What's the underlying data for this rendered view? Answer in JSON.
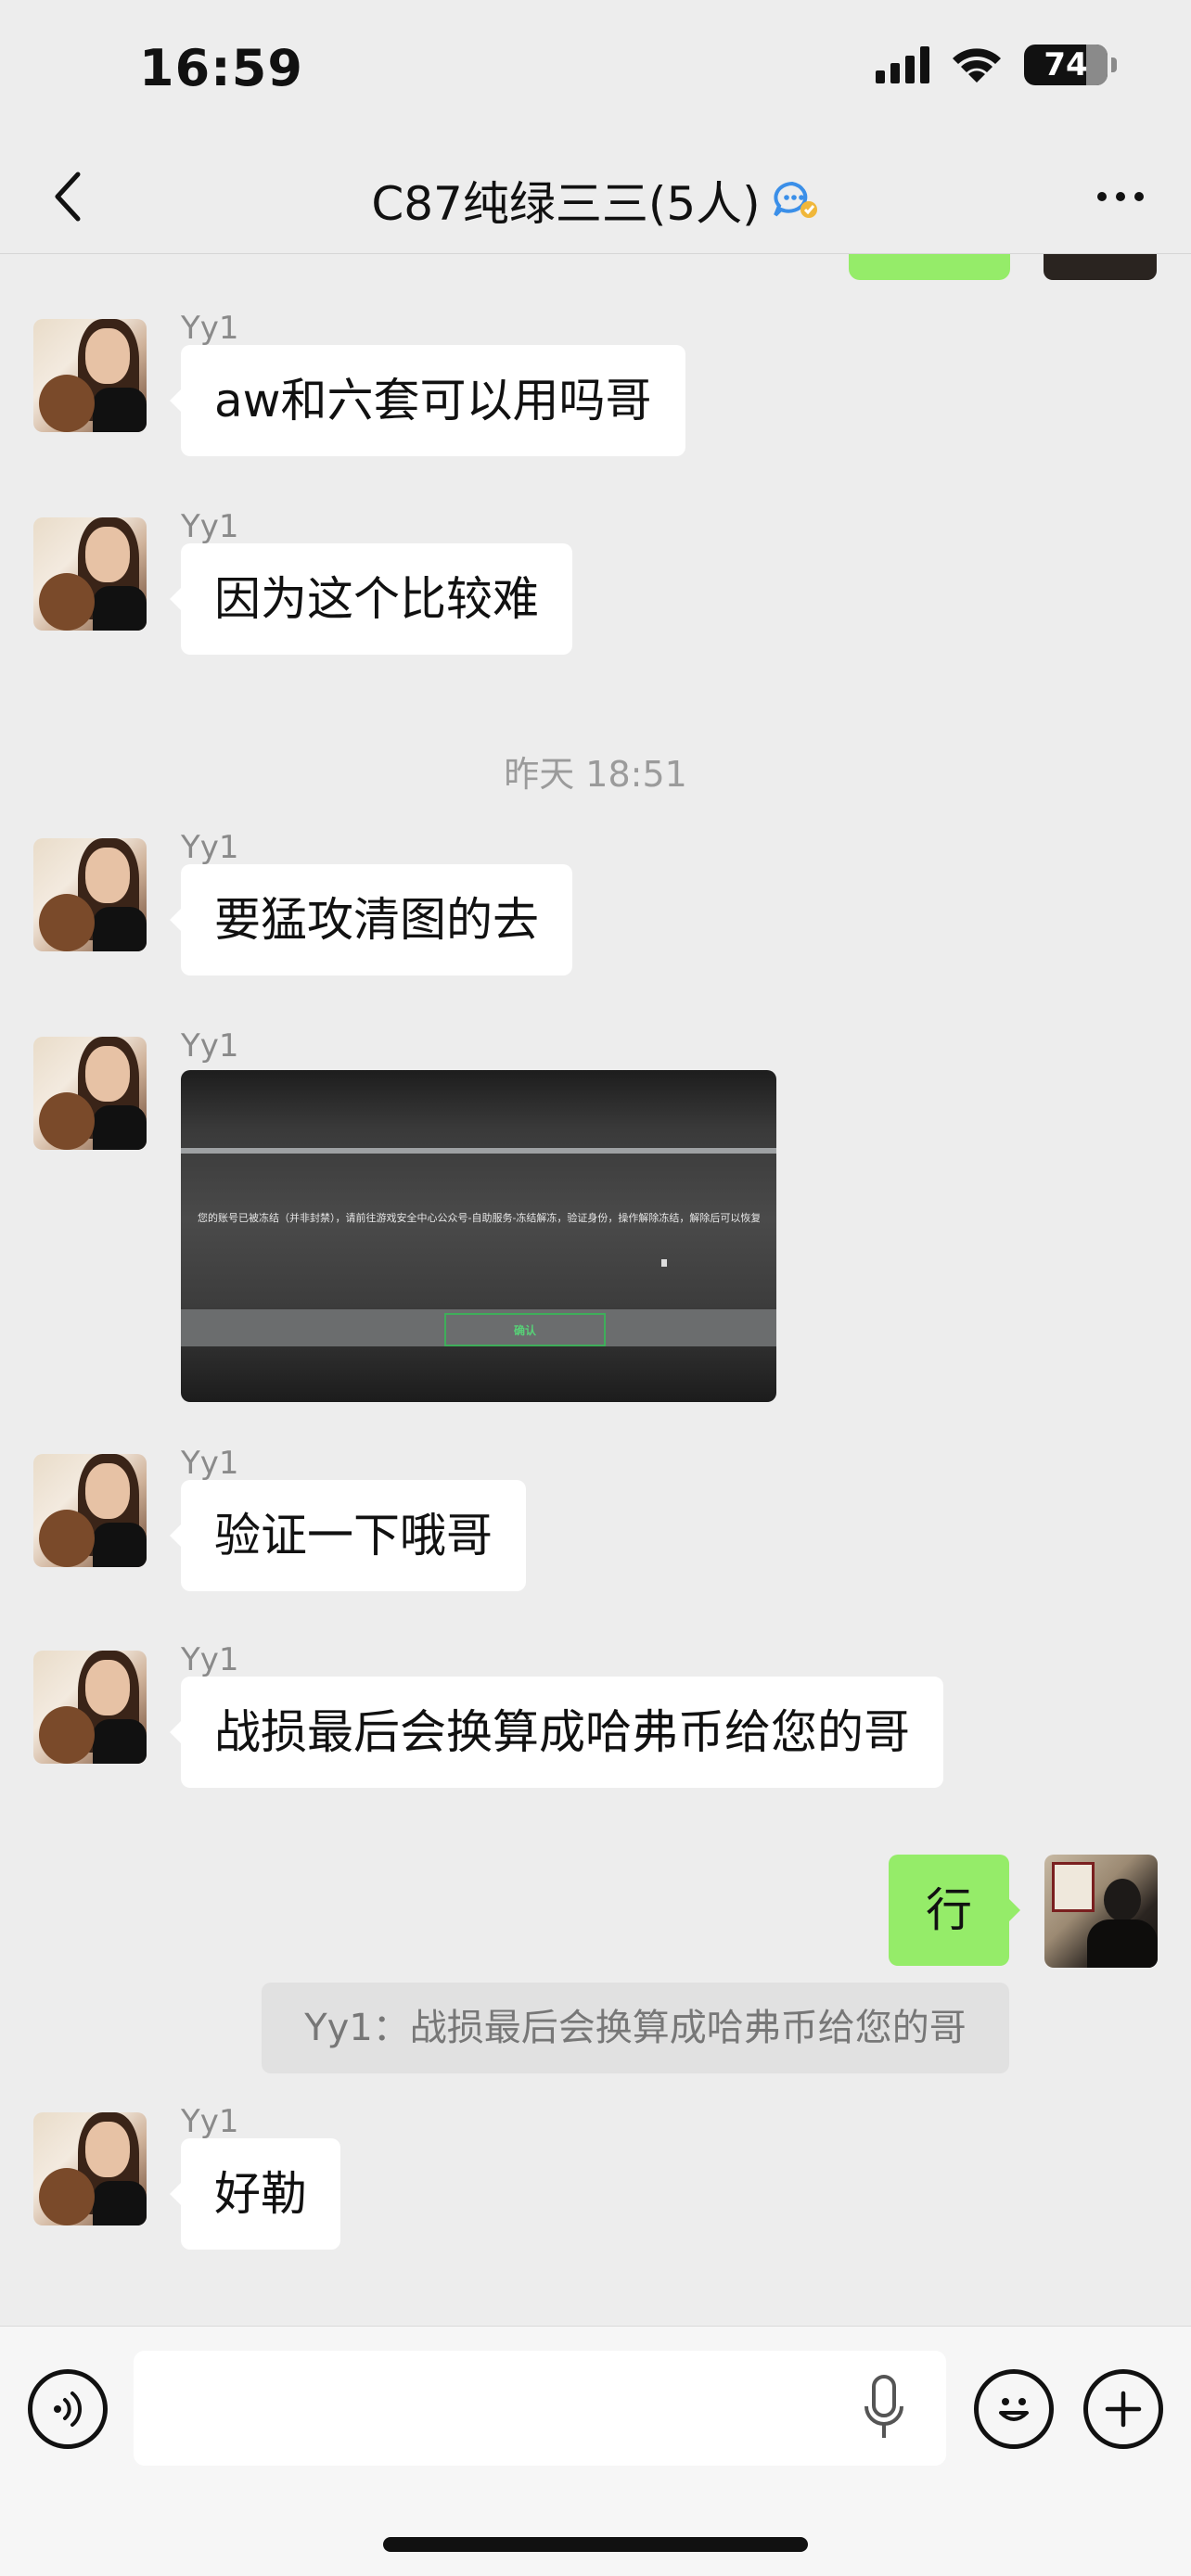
{
  "status_bar": {
    "time": "16:59",
    "battery": "74",
    "battery_level": 0.74,
    "icons": [
      "signal-icon",
      "wifi-icon",
      "battery-icon"
    ]
  },
  "header": {
    "title": "C87纯绿三三(5人)",
    "back_icon": "chevron-left-icon",
    "badge_icon": "chat-bubble-icon",
    "more_icon": "more-dots-icon"
  },
  "messages": [
    {
      "sender": "Yy1",
      "text": "aw和六套可以用吗哥"
    },
    {
      "sender": "Yy1",
      "text": "因为这个比较难"
    },
    {
      "timestamp": "昨天 18:51"
    },
    {
      "sender": "Yy1",
      "text": "要猛攻清图的去"
    },
    {
      "sender": "Yy1",
      "image": {
        "notice": "您的账号已被冻结（并非封禁），请前往游戏安全中心公众号-自助服务-冻结解冻，验证身份，操作解除冻结，解除后可以恢复正常游戏 您也可随时主动操作账号冻结以保护账号安全。",
        "button": "确认"
      }
    },
    {
      "sender": "Yy1",
      "text": "验证一下哦哥"
    },
    {
      "sender": "Yy1",
      "text": "战损最后会换算成哈弗币给您的哥"
    },
    {
      "me": true,
      "text": "行"
    },
    {
      "quote": "Yy1：战损最后会换算成哈弗币给您的哥"
    },
    {
      "sender": "Yy1",
      "text": "好勒"
    }
  ],
  "input": {
    "voice_icon": "voice-icon",
    "mic_icon": "mic-icon",
    "emoji_icon": "emoji-icon",
    "add_icon": "plus-icon",
    "value": "",
    "placeholder": ""
  },
  "colors": {
    "background": "#ededed",
    "my_bubble": "#95ec69",
    "their_bubble": "#ffffff",
    "badge": "#3b8fe8"
  }
}
